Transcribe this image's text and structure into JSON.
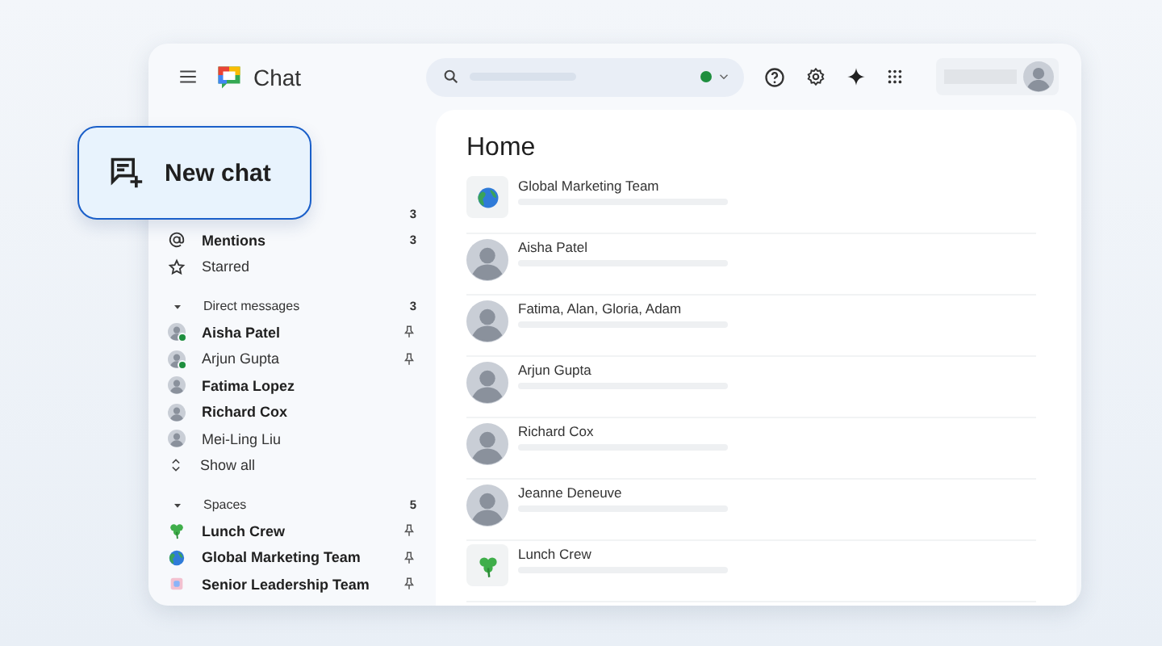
{
  "app": {
    "title": "Chat"
  },
  "new_chat_button": {
    "label": "New chat"
  },
  "sidebar": {
    "shortcuts": [
      {
        "kind": "hidden",
        "count": "3"
      },
      {
        "kind": "mentions",
        "label": "Mentions",
        "count": "3",
        "unread": true
      },
      {
        "kind": "starred",
        "label": "Starred",
        "unread": false
      }
    ],
    "sections": [
      {
        "title": "Direct messages",
        "count": "3",
        "expanded": true,
        "items": [
          {
            "kind": "person",
            "label": "Aisha Patel",
            "unread": true,
            "online": true,
            "pinned": true
          },
          {
            "kind": "person",
            "label": "Arjun Gupta",
            "unread": false,
            "online": true,
            "pinned": true
          },
          {
            "kind": "person",
            "label": "Fatima Lopez",
            "unread": true,
            "online": false,
            "pinned": false
          },
          {
            "kind": "person",
            "label": "Richard Cox",
            "unread": true,
            "online": false,
            "pinned": false
          },
          {
            "kind": "person",
            "label": "Mei-Ling Liu",
            "unread": false,
            "online": false,
            "pinned": false
          },
          {
            "kind": "show_all",
            "label": "Show all",
            "unread": false,
            "online": false,
            "pinned": false
          }
        ]
      },
      {
        "title": "Spaces",
        "count": "5",
        "expanded": true,
        "items": [
          {
            "kind": "shamrock",
            "label": "Lunch Crew",
            "unread": true,
            "pinned": true
          },
          {
            "kind": "globe",
            "label": "Global Marketing Team",
            "unread": true,
            "pinned": true
          },
          {
            "kind": "space",
            "label": "Senior Leadership Team",
            "unread": true,
            "pinned": true
          }
        ]
      }
    ]
  },
  "main": {
    "title": "Home",
    "conversations": [
      {
        "kind": "globe",
        "name": "Global Marketing Team"
      },
      {
        "kind": "person",
        "name": "Aisha Patel"
      },
      {
        "kind": "person",
        "name": "Fatima, Alan, Gloria, Adam"
      },
      {
        "kind": "person",
        "name": "Arjun Gupta"
      },
      {
        "kind": "person",
        "name": "Richard Cox"
      },
      {
        "kind": "person",
        "name": "Jeanne Deneuve"
      },
      {
        "kind": "shamrock",
        "name": "Lunch Crew"
      }
    ]
  },
  "status": {
    "online": true
  }
}
